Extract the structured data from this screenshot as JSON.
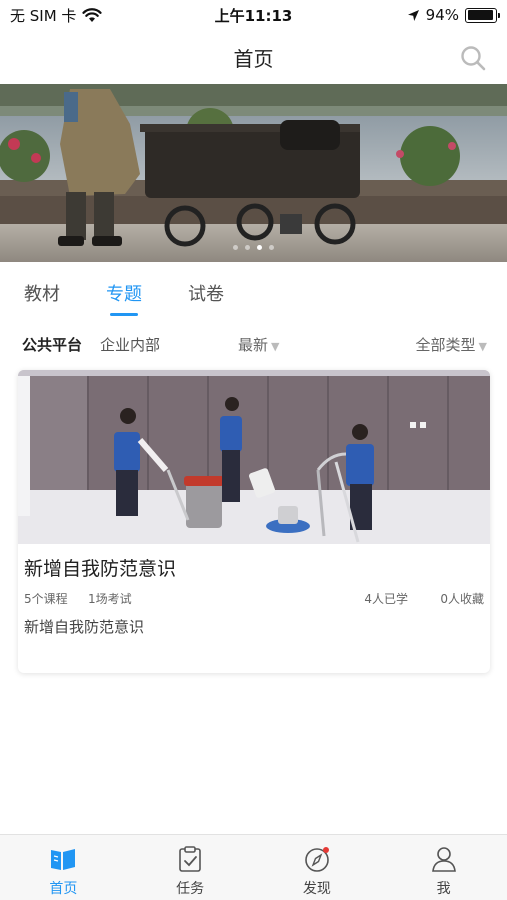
{
  "status_bar": {
    "carrier": "无 SIM 卡",
    "time": "上午11:13",
    "battery": "94%",
    "battery_level": 0.94
  },
  "nav": {
    "title": "首页",
    "search_icon": "search-icon"
  },
  "banner": {
    "slide_count": 4,
    "active_slide": 2
  },
  "tabs": [
    {
      "label": "教材",
      "active": false
    },
    {
      "label": "专题",
      "active": true
    },
    {
      "label": "试卷",
      "active": false
    }
  ],
  "filters": {
    "public": "公共平台",
    "internal": "企业内部",
    "sort": "最新",
    "type": "全部类型"
  },
  "cards": [
    {
      "title": "新增自我防范意识",
      "courses": "5个课程",
      "exams": "1场考试",
      "learned": "4人已学",
      "favorites": "0人收藏",
      "description": "新增自我防范意识"
    }
  ],
  "tab_bar": [
    {
      "label": "首页",
      "icon": "book-icon",
      "active": true
    },
    {
      "label": "任务",
      "icon": "task-clipboard-icon",
      "active": false
    },
    {
      "label": "发现",
      "icon": "compass-icon",
      "active": false
    },
    {
      "label": "我",
      "icon": "user-icon",
      "active": false
    }
  ],
  "colors": {
    "accent": "#2196f3",
    "badge": "#e53935"
  }
}
